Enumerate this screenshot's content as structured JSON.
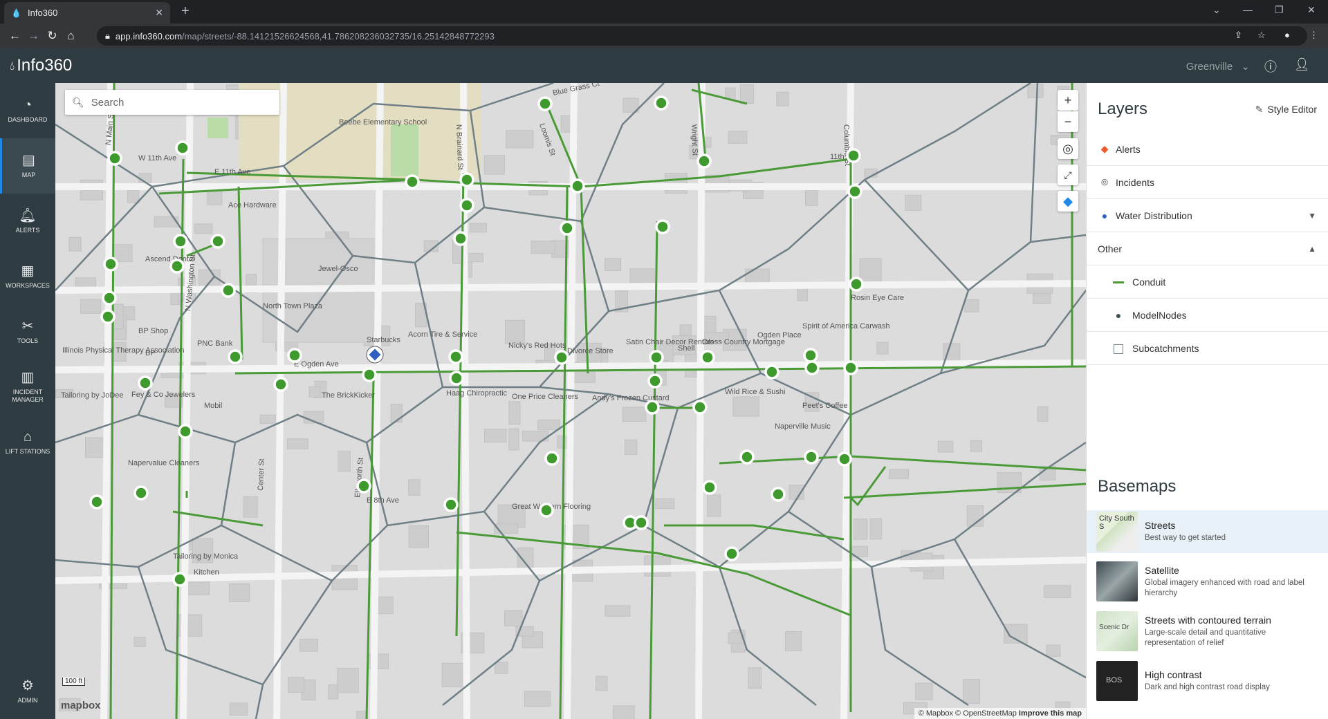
{
  "browser": {
    "tab_title": "Info360",
    "url_host": "app.info360.com",
    "url_path": "/map/streets/-88.14121526624568,41.786208236032735/16.25142848772293"
  },
  "header": {
    "app_name": "Info360",
    "tenant": "Greenville"
  },
  "sidenav": [
    {
      "label": "DASHBOARD",
      "icon": "dashboard-icon"
    },
    {
      "label": "MAP",
      "icon": "map-icon"
    },
    {
      "label": "ALERTS",
      "icon": "alerts-icon"
    },
    {
      "label": "WORKSPACES",
      "icon": "workspaces-icon"
    },
    {
      "label": "TOOLS",
      "icon": "tools-icon"
    },
    {
      "label": "INCIDENT MANAGER",
      "icon": "incident-manager-icon"
    },
    {
      "label": "LIFT STATIONS",
      "icon": "lift-stations-icon"
    },
    {
      "label": "ADMIN",
      "icon": "gear-icon"
    }
  ],
  "search": {
    "placeholder": "Search"
  },
  "map": {
    "scale": "100 ft",
    "attribution_brand": "mapbox",
    "attribution": "© Mapbox © OpenStreetMap",
    "improve": "Improve this map",
    "colors": {
      "conduit": "#4a9b38",
      "node": "#3e9a2c",
      "subcatchment": "#6f7f86"
    },
    "labels": [
      {
        "text": "Blue Grass Ct"
      },
      {
        "text": "Beebe Elementary School"
      },
      {
        "text": "N Brainard St"
      },
      {
        "text": "Loomis St"
      },
      {
        "text": "Wright St"
      },
      {
        "text": "Columbia St"
      },
      {
        "text": "W 11th Ave"
      },
      {
        "text": "E 11th Ave"
      },
      {
        "text": "11th Ave"
      },
      {
        "text": "Ace Hardware"
      },
      {
        "text": "Jewel-Osco"
      },
      {
        "text": "North Town Plaza"
      },
      {
        "text": "Ascend Dental"
      },
      {
        "text": "N Washington St"
      },
      {
        "text": "N Main St"
      },
      {
        "text": "BP Shop"
      },
      {
        "text": "BP"
      },
      {
        "text": "PNC Bank"
      },
      {
        "text": "Illinois Physical Therapy Association"
      },
      {
        "text": "Starbucks"
      },
      {
        "text": "Acorn Tire & Service"
      },
      {
        "text": "Nicky's Red Hots"
      },
      {
        "text": "Divorce Store"
      },
      {
        "text": "Satin Chair Decor Rentals"
      },
      {
        "text": "Shell"
      },
      {
        "text": "Cross Country Mortgage"
      },
      {
        "text": "Ogden Place"
      },
      {
        "text": "Spirit of America Carwash"
      },
      {
        "text": "Rosin Eye Care"
      },
      {
        "text": "E Ogden Ave"
      },
      {
        "text": "Tailoring by JoDee"
      },
      {
        "text": "Fey & Co Jewelers"
      },
      {
        "text": "Mobil"
      },
      {
        "text": "The BrickKicker"
      },
      {
        "text": "Haag Chiropractic"
      },
      {
        "text": "One Price Cleaners"
      },
      {
        "text": "Andy's Frozen Custard"
      },
      {
        "text": "Wild Rice & Sushi"
      },
      {
        "text": "Peet's Coffee"
      },
      {
        "text": "Naperville Music"
      },
      {
        "text": "Napervalue Cleaners"
      },
      {
        "text": "Center St"
      },
      {
        "text": "Ellsworth St"
      },
      {
        "text": "E 8th Ave"
      },
      {
        "text": "Great Western Flooring"
      },
      {
        "text": "Tailoring by Monica"
      },
      {
        "text": "Kitchen"
      }
    ]
  },
  "layers": {
    "title": "Layers",
    "style_editor": "Style Editor",
    "items": [
      {
        "label": "Alerts",
        "icon": "alert-icon",
        "color": "#f05a28"
      },
      {
        "label": "Incidents",
        "icon": "incidents-icon"
      },
      {
        "label": "Water Distribution",
        "icon": "dot-icon",
        "color": "#2f5fbf"
      }
    ],
    "group": "Other",
    "group_items": [
      {
        "label": "Conduit",
        "icon": "line-icon",
        "color": "#4a9b38"
      },
      {
        "label": "ModelNodes",
        "icon": "dot-icon",
        "color": "#3d4f55"
      },
      {
        "label": "Subcatchments",
        "icon": "checkbox-icon"
      }
    ]
  },
  "basemaps": {
    "title": "Basemaps",
    "items": [
      {
        "name": "Streets",
        "desc": "Best way to get started",
        "thumb_text": "City South S"
      },
      {
        "name": "Satellite",
        "desc": "Global imagery enhanced with road and label hierarchy",
        "thumb_text": ""
      },
      {
        "name": "Streets with contoured terrain",
        "desc": "Large-scale detail and quantitative representation of relief",
        "thumb_text": "Scenic Dr"
      },
      {
        "name": "High contrast",
        "desc": "Dark and high contrast road display",
        "thumb_text": "BOS"
      }
    ]
  }
}
